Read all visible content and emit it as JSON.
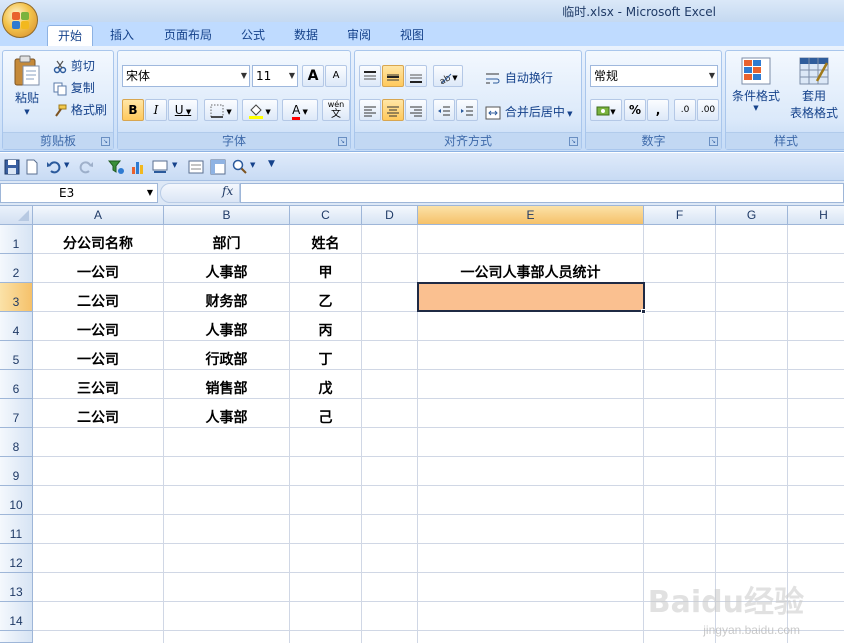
{
  "window": {
    "title": "临时.xlsx - Microsoft Excel"
  },
  "ribbon": {
    "tabs": [
      "开始",
      "插入",
      "页面布局",
      "公式",
      "数据",
      "审阅",
      "视图"
    ],
    "active_tab": "开始",
    "clipboard": {
      "paste": "粘贴",
      "cut": "剪切",
      "copy": "复制",
      "format_painter": "格式刷",
      "label": "剪贴板"
    },
    "font": {
      "name": "宋体",
      "size": "11",
      "grow": "A",
      "shrink": "A",
      "bold": "B",
      "italic": "I",
      "underline": "U",
      "font_color": "A",
      "phonetic": "wén",
      "label": "字体"
    },
    "alignment": {
      "wrap_text": "自动换行",
      "merge_center": "合并后居中",
      "label": "对齐方式"
    },
    "number": {
      "format": "常规",
      "percent": "%",
      "comma": ",",
      "inc_decimal": ".0",
      "dec_decimal": ".00",
      "label": "数字"
    },
    "styles": {
      "conditional": "条件格式",
      "table_format_1": "套用",
      "table_format_2": "表格格式",
      "label": "样式"
    }
  },
  "formula_bar": {
    "name_box": "E3",
    "fx": "fx",
    "value": ""
  },
  "sheet": {
    "columns": [
      "A",
      "B",
      "C",
      "D",
      "E",
      "F",
      "G",
      "H"
    ],
    "rows": [
      "1",
      "2",
      "3",
      "4",
      "5",
      "6",
      "7",
      "8",
      "9",
      "10",
      "11",
      "12",
      "13",
      "14"
    ],
    "selected_cell": "E3",
    "selected_fill": "#fac090",
    "cells": {
      "A1": "分公司名称",
      "B1": "部门",
      "C1": "姓名",
      "A2": "一公司",
      "B2": "人事部",
      "C2": "甲",
      "E2": "一公司人事部人员统计",
      "A3": "二公司",
      "B3": "财务部",
      "C3": "乙",
      "A4": "一公司",
      "B4": "人事部",
      "C4": "丙",
      "A5": "一公司",
      "B5": "行政部",
      "C5": "丁",
      "A6": "三公司",
      "B6": "销售部",
      "C6": "戊",
      "A7": "二公司",
      "B7": "人事部",
      "C7": "己"
    }
  },
  "watermark": {
    "brand": "Baidu经验",
    "url": "jingyan.baidu.com"
  }
}
